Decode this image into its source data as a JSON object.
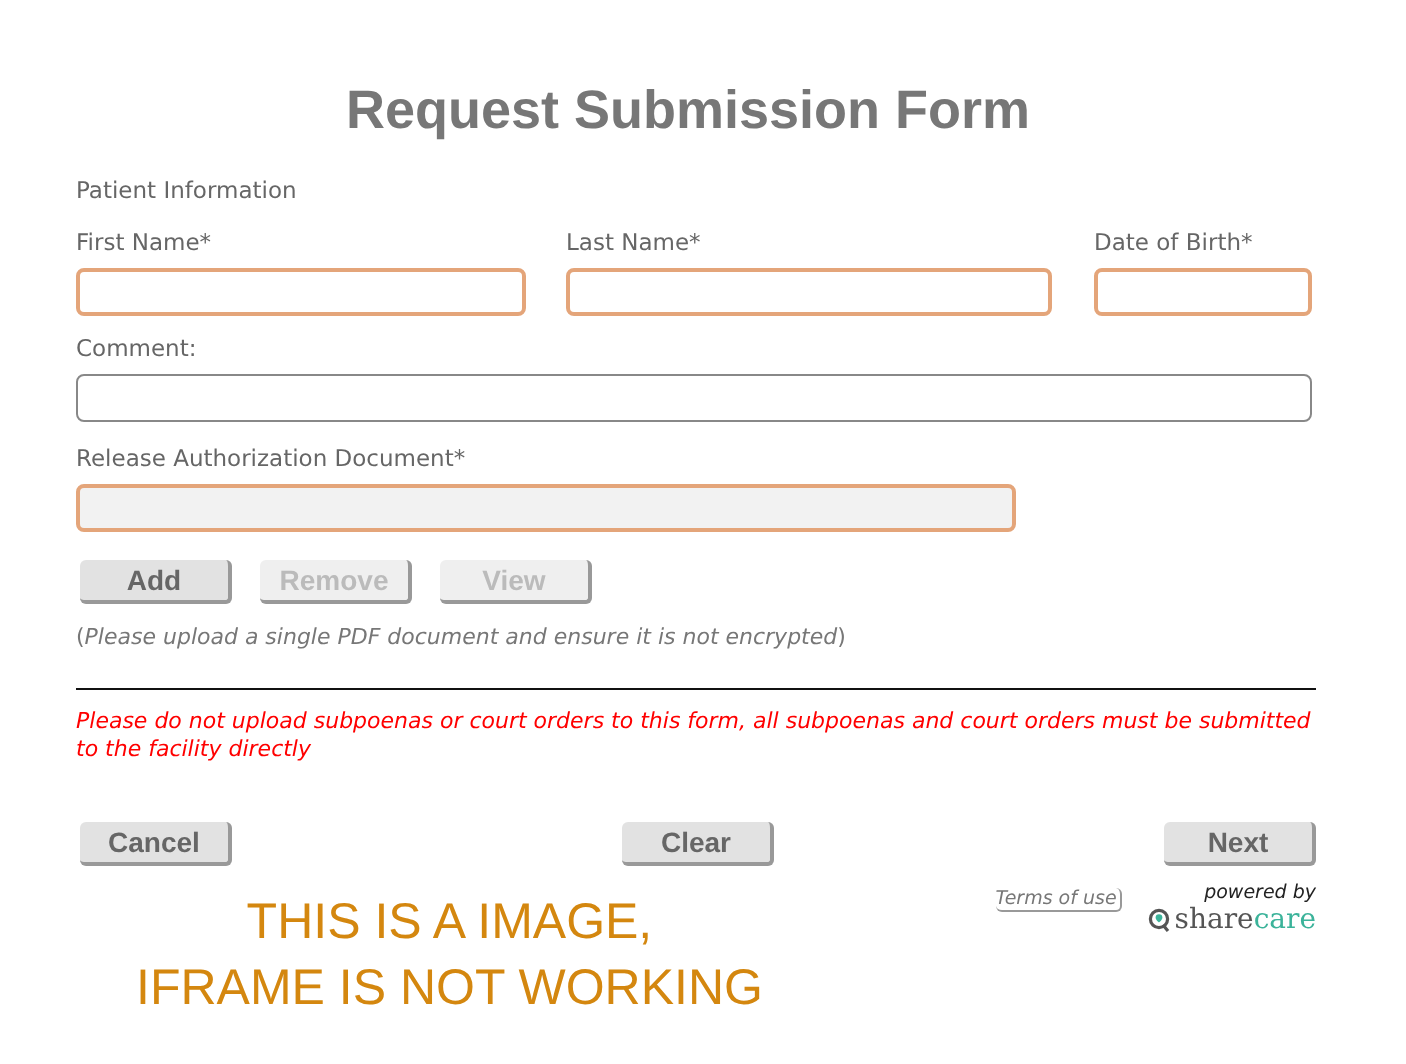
{
  "title": "Request Submission Form",
  "section_label": "Patient Information",
  "name_fields": [
    {
      "label": "First Name*",
      "highlighted": true
    },
    {
      "label": "Last Name*",
      "highlighted": true
    },
    {
      "label": "Date of Birth*",
      "highlighted": true
    }
  ],
  "comment_field": {
    "label": "Comment:",
    "highlighted": false
  },
  "document_field": {
    "label": "Release Authorization Document*",
    "highlighted": true,
    "disabled": true
  },
  "document_buttons": [
    {
      "label": "Add",
      "disabled": false
    },
    {
      "label": "Remove",
      "disabled": true
    },
    {
      "label": "View",
      "disabled": true
    }
  ],
  "upload_hint": "(*Please upload a single PDF document and ensure it is not encrypted*)",
  "warning": "Please do not upload subpoenas or court orders to this form, all subpoenas and court orders must be submitted to the facility directly",
  "actions": [
    {
      "label": "Cancel",
      "disabled": false
    },
    {
      "label": "Clear",
      "disabled": false
    },
    {
      "label": "Next",
      "disabled": false
    }
  ],
  "notice": [
    "THIS IS A IMAGE,",
    "IFRAME IS NOT WORKING"
  ],
  "footer": {
    "terms_link": "Terms of use",
    "powered_by": "powered by",
    "logo": [
      "share",
      "care"
    ]
  }
}
